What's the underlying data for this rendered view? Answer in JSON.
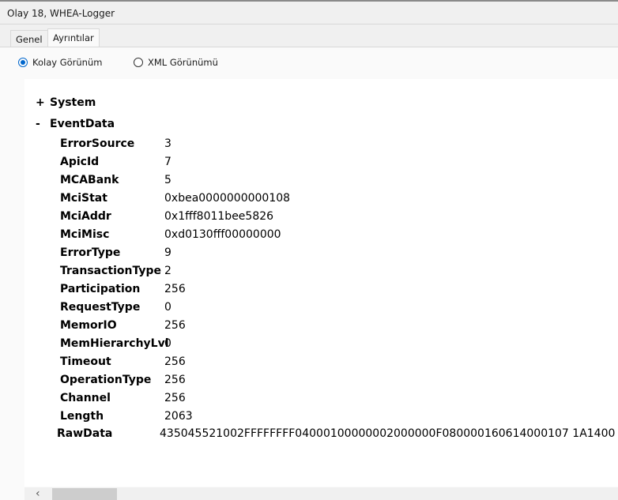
{
  "window": {
    "title": "Olay 18, WHEA-Logger"
  },
  "tabs": [
    {
      "label": "Genel"
    },
    {
      "label": "Ayrıntılar"
    }
  ],
  "view_options": {
    "friendly": {
      "label": "Kolay Görünüm",
      "selected": true
    },
    "xml": {
      "label": "XML Görünümü",
      "selected": false
    }
  },
  "tree": {
    "system": {
      "toggle": "+",
      "label": "System"
    },
    "eventdata": {
      "toggle": "-",
      "label": "EventData"
    },
    "rows": [
      {
        "key": "ErrorSource",
        "value": "3"
      },
      {
        "key": "ApicId",
        "value": "7"
      },
      {
        "key": "MCABank",
        "value": "5"
      },
      {
        "key": "MciStat",
        "value": "0xbea0000000000108"
      },
      {
        "key": "MciAddr",
        "value": "0x1fff8011bee5826"
      },
      {
        "key": "MciMisc",
        "value": "0xd0130fff00000000"
      },
      {
        "key": "ErrorType",
        "value": "9"
      },
      {
        "key": "TransactionType",
        "value": "2"
      },
      {
        "key": "Participation",
        "value": "256"
      },
      {
        "key": "RequestType",
        "value": "0"
      },
      {
        "key": "MemorIO",
        "value": "256"
      },
      {
        "key": "MemHierarchyLvl",
        "value": "0"
      },
      {
        "key": "Timeout",
        "value": "256"
      },
      {
        "key": "OperationType",
        "value": "256"
      },
      {
        "key": "Channel",
        "value": "256"
      },
      {
        "key": "Length",
        "value": "2063"
      }
    ],
    "rawdata": {
      "key": "RawData",
      "value": "435045521002FFFFFFFF04000100000002000000F080000160614000107 1A1400"
    }
  },
  "scrollbar": {
    "left_arrow": "‹"
  }
}
